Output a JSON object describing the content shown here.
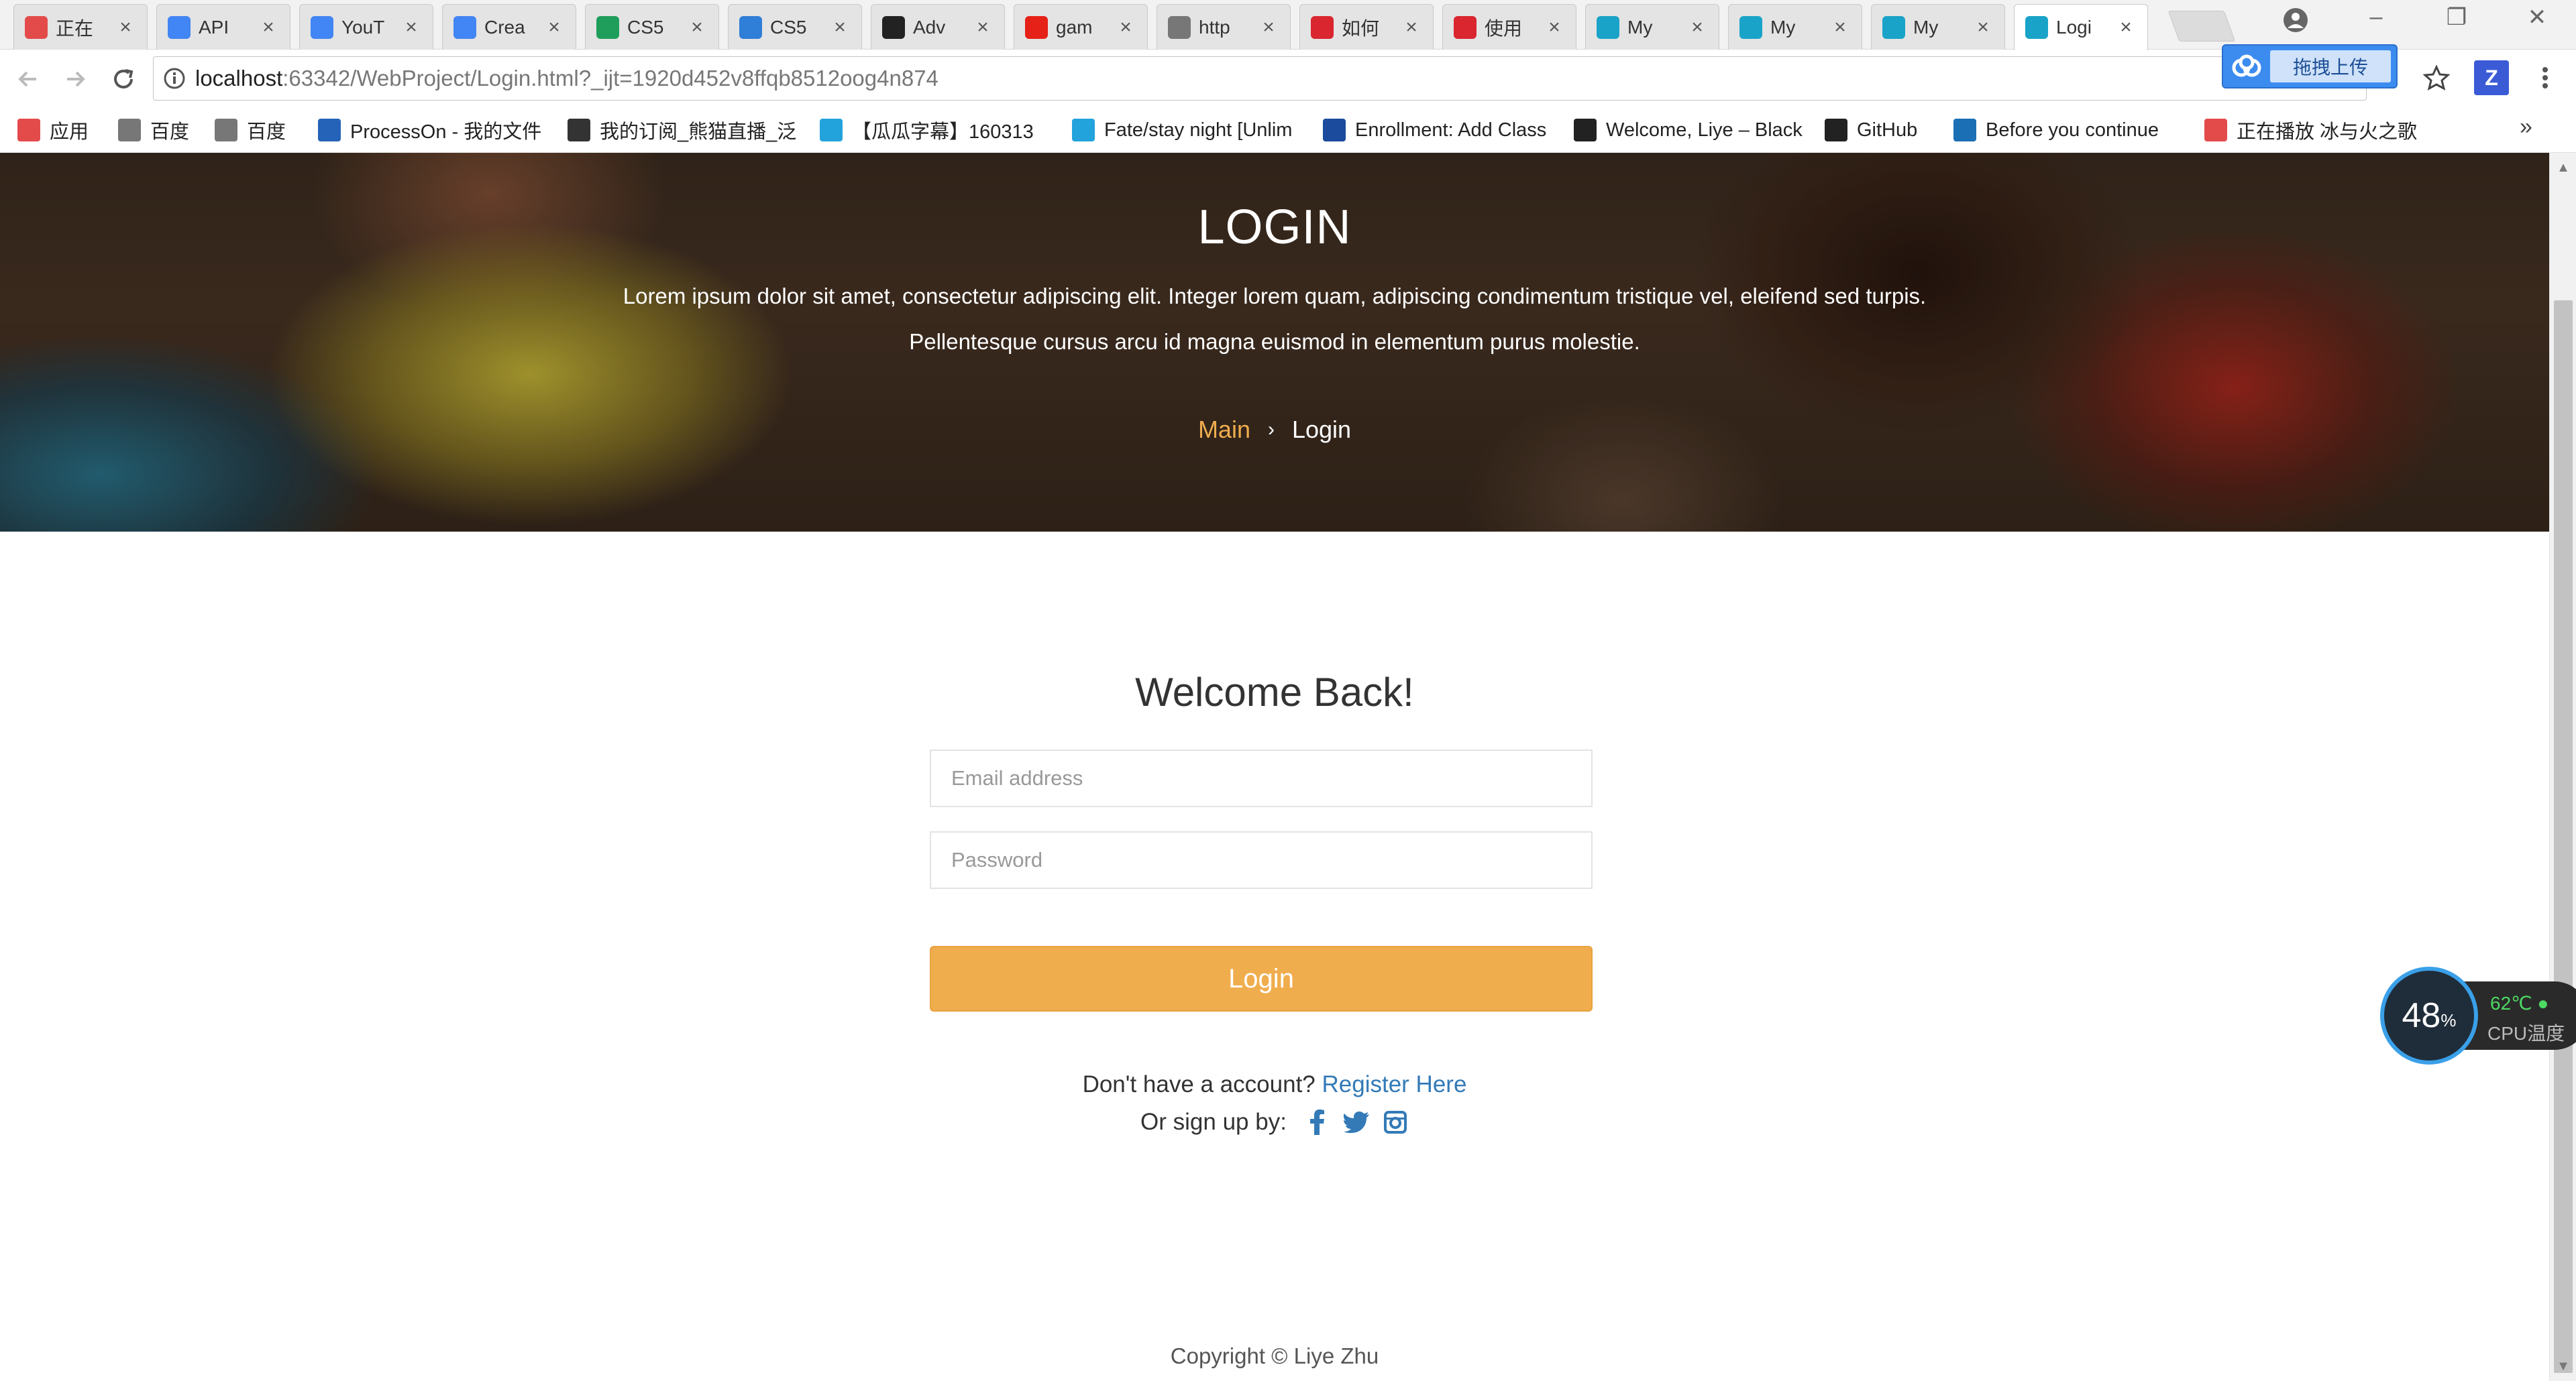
{
  "browser": {
    "tabs": [
      {
        "title": "正在",
        "icon": "swirl-icon",
        "color": "#e34b4b"
      },
      {
        "title": "API",
        "icon": "google-icon",
        "color": "#4285f4"
      },
      {
        "title": "YouT",
        "icon": "google-icon",
        "color": "#4285f4"
      },
      {
        "title": "Crea",
        "icon": "google-icon",
        "color": "#4285f4"
      },
      {
        "title": "CS5",
        "icon": "sheets-icon",
        "color": "#1e9e5a"
      },
      {
        "title": "CS5",
        "icon": "box-icon",
        "color": "#2f7ed8"
      },
      {
        "title": "Adv",
        "icon": "github-icon",
        "color": "#222222"
      },
      {
        "title": "gam",
        "icon": "youtube-icon",
        "color": "#e62117"
      },
      {
        "title": "http",
        "icon": "page-icon",
        "color": "#777777"
      },
      {
        "title": "如何",
        "icon": "csdn-icon",
        "color": "#d9262f"
      },
      {
        "title": "使用",
        "icon": "baidu-icon",
        "color": "#d9262f"
      },
      {
        "title": "My",
        "icon": "webstorm-icon",
        "color": "#1aa3c8"
      },
      {
        "title": "My",
        "icon": "webstorm-icon",
        "color": "#1aa3c8"
      },
      {
        "title": "My",
        "icon": "webstorm-icon",
        "color": "#1aa3c8"
      },
      {
        "title": "Logi",
        "icon": "webstorm-icon",
        "color": "#1aa3c8",
        "active": true
      }
    ],
    "upload_label": "拖拽上传",
    "url_host": "localhost",
    "url_rest": ":63342/WebProject/Login.html?_ijt=1920d452v8ffqb8512oog4n874",
    "bookmarks": [
      {
        "label": "应用",
        "icon": "apps-grid-icon",
        "color": "#e34b4b"
      },
      {
        "label": "百度",
        "icon": "page-icon",
        "color": "#777777"
      },
      {
        "label": "百度",
        "icon": "page-icon",
        "color": "#777777"
      },
      {
        "label": "ProcessOn - 我的文件",
        "icon": "processon-icon",
        "color": "#2563b8"
      },
      {
        "label": "我的订阅_熊猫直播_泛",
        "icon": "panda-icon",
        "color": "#333333"
      },
      {
        "label": "【瓜瓜字幕】160313",
        "icon": "bilibili-icon",
        "color": "#23a3dc"
      },
      {
        "label": "Fate/stay night [Unlim",
        "icon": "bilibili-icon",
        "color": "#23a3dc"
      },
      {
        "label": "Enrollment: Add Class",
        "icon": "enrollment-icon",
        "color": "#1a4b9c"
      },
      {
        "label": "Welcome, Liye – Black",
        "icon": "blackboard-icon",
        "color": "#222222"
      },
      {
        "label": "GitHub",
        "icon": "github-icon",
        "color": "#222222"
      },
      {
        "label": "Before you continue",
        "icon": "jf-icon",
        "color": "#1a6fb5"
      },
      {
        "label": "正在播放 冰与火之歌",
        "icon": "swirl-icon",
        "color": "#e34b4b"
      }
    ]
  },
  "hero": {
    "title": "LOGIN",
    "text": "Lorem ipsum dolor sit amet, consectetur adipiscing elit. Integer lorem quam, adipiscing condimentum tristique vel, eleifend sed turpis. Pellentesque cursus arcu id magna euismod in elementum purus molestie.",
    "breadcrumb": {
      "main": "Main",
      "current": "Login"
    }
  },
  "form": {
    "heading": "Welcome Back!",
    "email_placeholder": "Email address",
    "password_placeholder": "Password",
    "login_label": "Login"
  },
  "footer": {
    "no_account": "Don't have a account?",
    "register_link": "Register Here",
    "signup_text": "Or sign up by:",
    "social": [
      "facebook-icon",
      "twitter-icon",
      "instagram-icon"
    ],
    "copyright": "Copyright © Liye Zhu"
  },
  "cpu_widget": {
    "usage": "48",
    "usage_unit": "%",
    "temp": "62℃",
    "label": "CPU温度"
  },
  "colors": {
    "accent": "#f0ad4e",
    "link": "#337ab7"
  }
}
